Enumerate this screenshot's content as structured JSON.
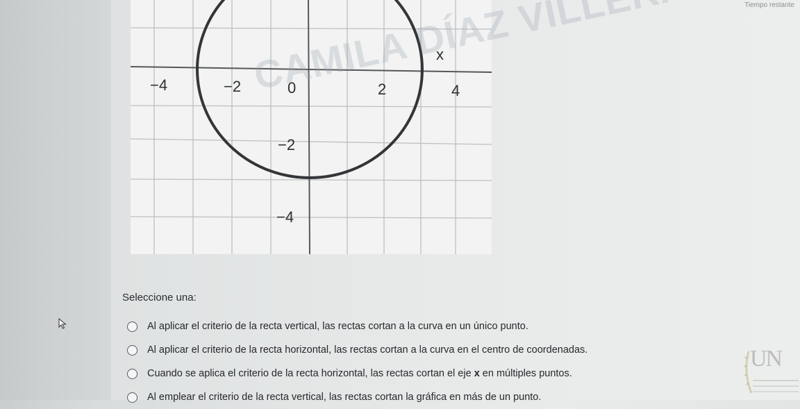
{
  "timer": {
    "label": "Tiempo restante"
  },
  "graph": {
    "axis_label_x": "x",
    "x_ticks": [
      "−4",
      "−2",
      "0",
      "2",
      "4"
    ],
    "y_ticks": [
      "−2",
      "−4"
    ],
    "watermark": "CAMILA DÍAZ VILLERA"
  },
  "question": {
    "prompt": "Seleccione una:",
    "options": [
      {
        "text": "Al aplicar el criterio de la recta vertical, las rectas cortan a la curva en un único punto.",
        "selected": false
      },
      {
        "text": "Al aplicar el criterio de la recta horizontal, las rectas cortan a la curva en el centro de coordenadas.",
        "selected": false
      },
      {
        "text_before": "Cuando se aplica el criterio de la recta horizontal, las rectas cortan el eje ",
        "text_var": "x",
        "text_after": " en múltiples puntos.",
        "selected": false
      },
      {
        "text": "Al emplear el criterio de la recta vertical, las rectas cortan la gráfica en más de un punto.",
        "selected": false
      }
    ]
  },
  "logo": {
    "letters": "UN"
  },
  "colors": {
    "curve": "#333538",
    "grid": "#b8bcbc",
    "axis": "#5a5d60"
  }
}
